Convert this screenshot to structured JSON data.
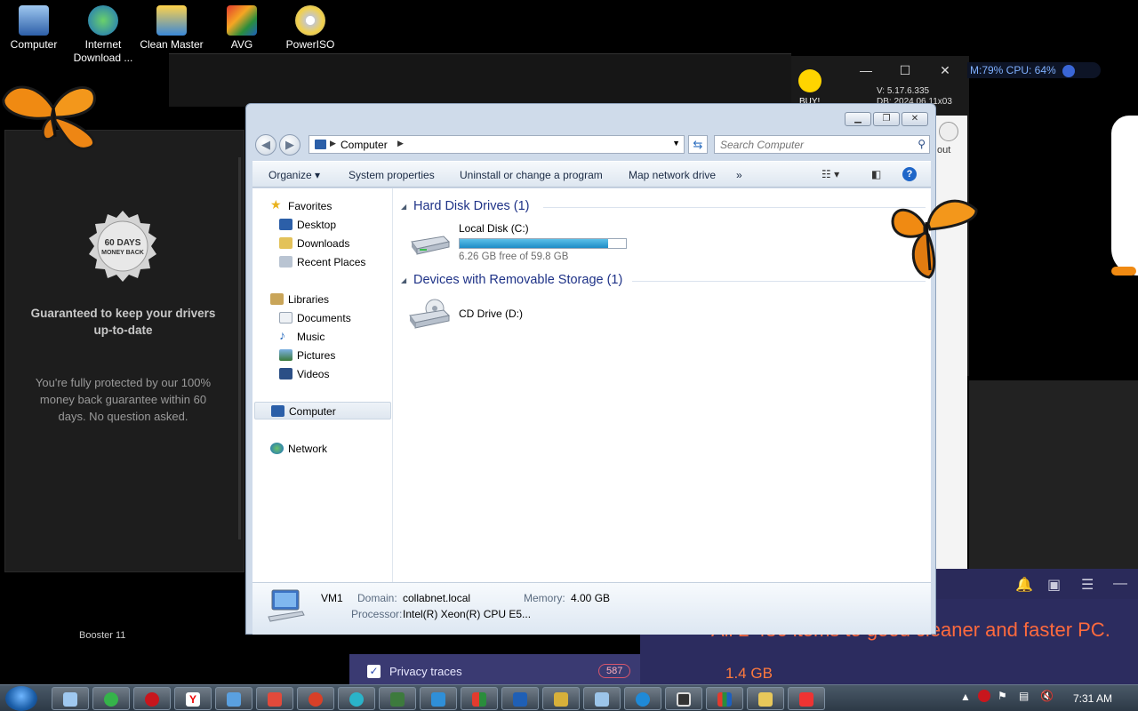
{
  "desktop": {
    "icons": [
      {
        "label": "Computer"
      },
      {
        "label": "Internet\nDownload ..."
      },
      {
        "label": "Clean Master"
      },
      {
        "label": "AVG"
      },
      {
        "label": "PowerISO"
      }
    ]
  },
  "background_app": {
    "seal_text": "60 DAYS MONEY BACK",
    "heading": "Guaranteed to keep your drivers up-to-date",
    "body": "You're fully protected by our 100% money back guarantee within 60 days. No question asked.",
    "taskbar_label": "Booster 11"
  },
  "right_app": {
    "buy_label": "BUY!",
    "version": "V: 5.17.6.335",
    "db": "DB: 2024.06.11x03",
    "logout_label": "out"
  },
  "sysmon": {
    "text": "M:79%  CPU: 64%"
  },
  "cleaner": {
    "headline": "All 2 486 items to good cleaner and faster PC.",
    "size": "1.4 GB",
    "privacy_label": "Privacy traces",
    "privacy_count": "587"
  },
  "explorer": {
    "address": {
      "crumb": "Computer"
    },
    "search": {
      "placeholder": "Search Computer"
    },
    "toolbar": {
      "organize": "Organize",
      "system_properties": "System properties",
      "uninstall": "Uninstall or change a program",
      "map_network": "Map network drive",
      "more": "»"
    },
    "nav": {
      "favorites": "Favorites",
      "desktop": "Desktop",
      "downloads": "Downloads",
      "recent": "Recent Places",
      "libraries": "Libraries",
      "documents": "Documents",
      "music": "Music",
      "pictures": "Pictures",
      "videos": "Videos",
      "computer": "Computer",
      "network": "Network"
    },
    "groups": {
      "hdd": "Hard Disk Drives (1)",
      "removable": "Devices with Removable Storage (1)"
    },
    "drives": {
      "c_name": "Local Disk (C:)",
      "c_free": "6.26 GB free of 59.8 GB",
      "c_used_fraction": 0.895,
      "d_name": "CD Drive (D:)"
    },
    "details": {
      "name": "VM1",
      "domain_label": "Domain:",
      "domain": "collabnet.local",
      "memory_label": "Memory:",
      "memory": "4.00 GB",
      "processor_label": "Processor:",
      "processor": "Intel(R) Xeon(R) CPU E5..."
    }
  },
  "taskbar": {
    "clock": "7:31 AM"
  },
  "colors": {
    "accent": "#1e3287",
    "bar_fill": "#1e8cc6",
    "cleaner_orange": "#ff6a3d"
  }
}
